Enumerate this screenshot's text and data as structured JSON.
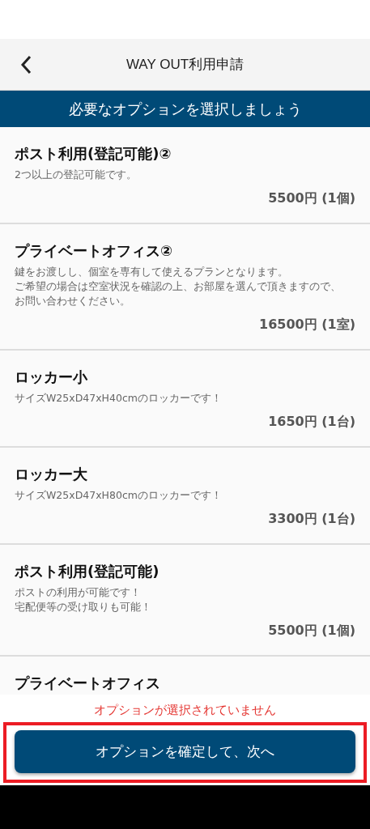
{
  "header": {
    "title": "WAY OUT利用申請"
  },
  "banner": "必要なオプションを選択しましょう",
  "options": [
    {
      "title": "ポスト利用(登記可能)②",
      "description": [
        "2つ以上の登記可能です。"
      ],
      "price": "5500円 (1個)"
    },
    {
      "title": "プライベートオフィス②",
      "description": [
        "鍵をお渡しし、個室を専有して使えるプランとなります。",
        "ご希望の場合は空室状況を確認の上、お部屋を選んで頂きますので、",
        "お問い合わせください。"
      ],
      "price": "16500円 (1室)"
    },
    {
      "title": "ロッカー小",
      "description": [
        "サイズW25xD47xH40cmのロッカーです！"
      ],
      "price": "1650円 (1台)"
    },
    {
      "title": "ロッカー大",
      "description": [
        "サイズW25xD47xH80cmのロッカーです！"
      ],
      "price": "3300円 (1台)"
    },
    {
      "title": "ポスト利用(登記可能)",
      "description": [
        "ポストの利用が可能です！",
        "宅配便等の受け取りも可能！"
      ],
      "price": "5500円 (1個)"
    },
    {
      "title": "プライベートオフィス"
    }
  ],
  "footer": {
    "error": "オプションが選択されていません",
    "button": "オプションを確定して、次へ",
    "highlighted": true
  }
}
